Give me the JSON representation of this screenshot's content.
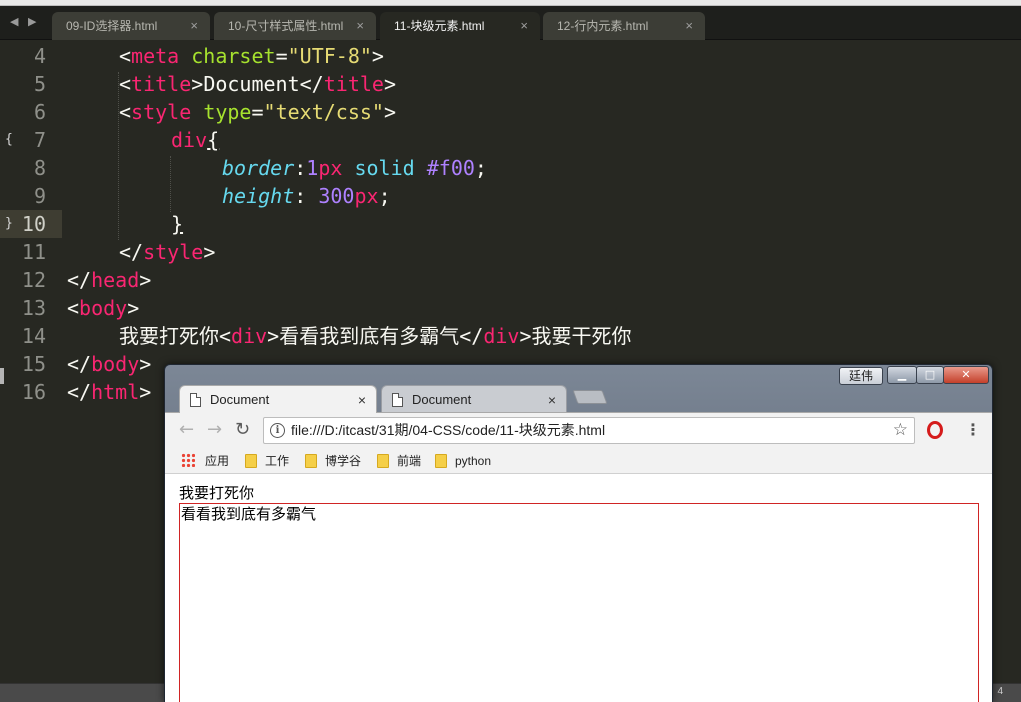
{
  "editor": {
    "tabs": [
      {
        "label": "09-ID选择器.html",
        "close": "×"
      },
      {
        "label": "10-尺寸样式属性.html",
        "close": "×"
      },
      {
        "label": "11-块级元素.html",
        "close": "×"
      },
      {
        "label": "12-行内元素.html",
        "close": "×"
      }
    ],
    "nav_prev": "◀",
    "nav_next": "▶",
    "fold_open": "{",
    "fold_close": "}",
    "lines": [
      {
        "number": "4",
        "tokens": [
          "<",
          "meta",
          " ",
          "charset",
          "=",
          "\"UTF-8\"",
          ">"
        ]
      },
      {
        "number": "5",
        "tokens": [
          "<",
          "title",
          ">",
          "Document",
          "</",
          "title",
          ">"
        ]
      },
      {
        "number": "6",
        "tokens": [
          "<",
          "style",
          " ",
          "type",
          "=",
          "\"text/css\"",
          ">"
        ]
      },
      {
        "number": "7",
        "tokens": [
          "div",
          "{"
        ]
      },
      {
        "number": "8",
        "tokens": [
          "border",
          ":",
          "1",
          "px",
          " solid ",
          "#f00",
          ";"
        ]
      },
      {
        "number": "9",
        "tokens": [
          "height",
          ": ",
          "300",
          "px",
          ";"
        ]
      },
      {
        "number": "10",
        "tokens": [
          "}"
        ]
      },
      {
        "number": "11",
        "tokens": [
          "</",
          "style",
          ">"
        ]
      },
      {
        "number": "12",
        "tokens": [
          "</",
          "head",
          ">"
        ]
      },
      {
        "number": "13",
        "tokens": [
          "<",
          "body",
          ">"
        ]
      },
      {
        "number": "14",
        "tokens": [
          "我要打死你",
          "<",
          "div",
          ">",
          "看看我到底有多霸气",
          "</",
          "div",
          ">",
          "我要干死你"
        ]
      },
      {
        "number": "15",
        "tokens": [
          "</",
          "body",
          ">"
        ]
      },
      {
        "number": "16",
        "tokens": [
          "</",
          "html",
          ">"
        ]
      }
    ],
    "status_right": "4",
    "colors": {
      "background": "#272822",
      "tag": "#f92672",
      "attribute": "#a6e22e",
      "string": "#e6db74",
      "property": "#66d9ef",
      "number": "#ae81ff"
    }
  },
  "browser": {
    "user_badge": "廷伟",
    "window_buttons": {
      "minimize": "▁",
      "maximize": "□",
      "close": "✕"
    },
    "tabs": [
      {
        "label": "Document",
        "close": "×",
        "active": true
      },
      {
        "label": "Document",
        "close": "×",
        "active": false
      }
    ],
    "nav": {
      "back": "←",
      "forward": "→",
      "reload": "↻"
    },
    "omnibox": {
      "info": "i",
      "url": "file:///D:/itcast/31期/04-CSS/code/11-块级元素.html",
      "star": "☆"
    },
    "menu": "⋮",
    "bookmarks": [
      {
        "label": "应用",
        "icon": "apps-grid-icon"
      },
      {
        "label": "工作",
        "icon": "folder-icon"
      },
      {
        "label": "博学谷",
        "icon": "folder-icon"
      },
      {
        "label": "前端",
        "icon": "folder-icon"
      },
      {
        "label": "python",
        "icon": "folder-icon"
      }
    ],
    "page": {
      "text_before": "我要打死你",
      "div_text": "看看我到底有多霸气",
      "div_border_color": "#f00"
    }
  }
}
